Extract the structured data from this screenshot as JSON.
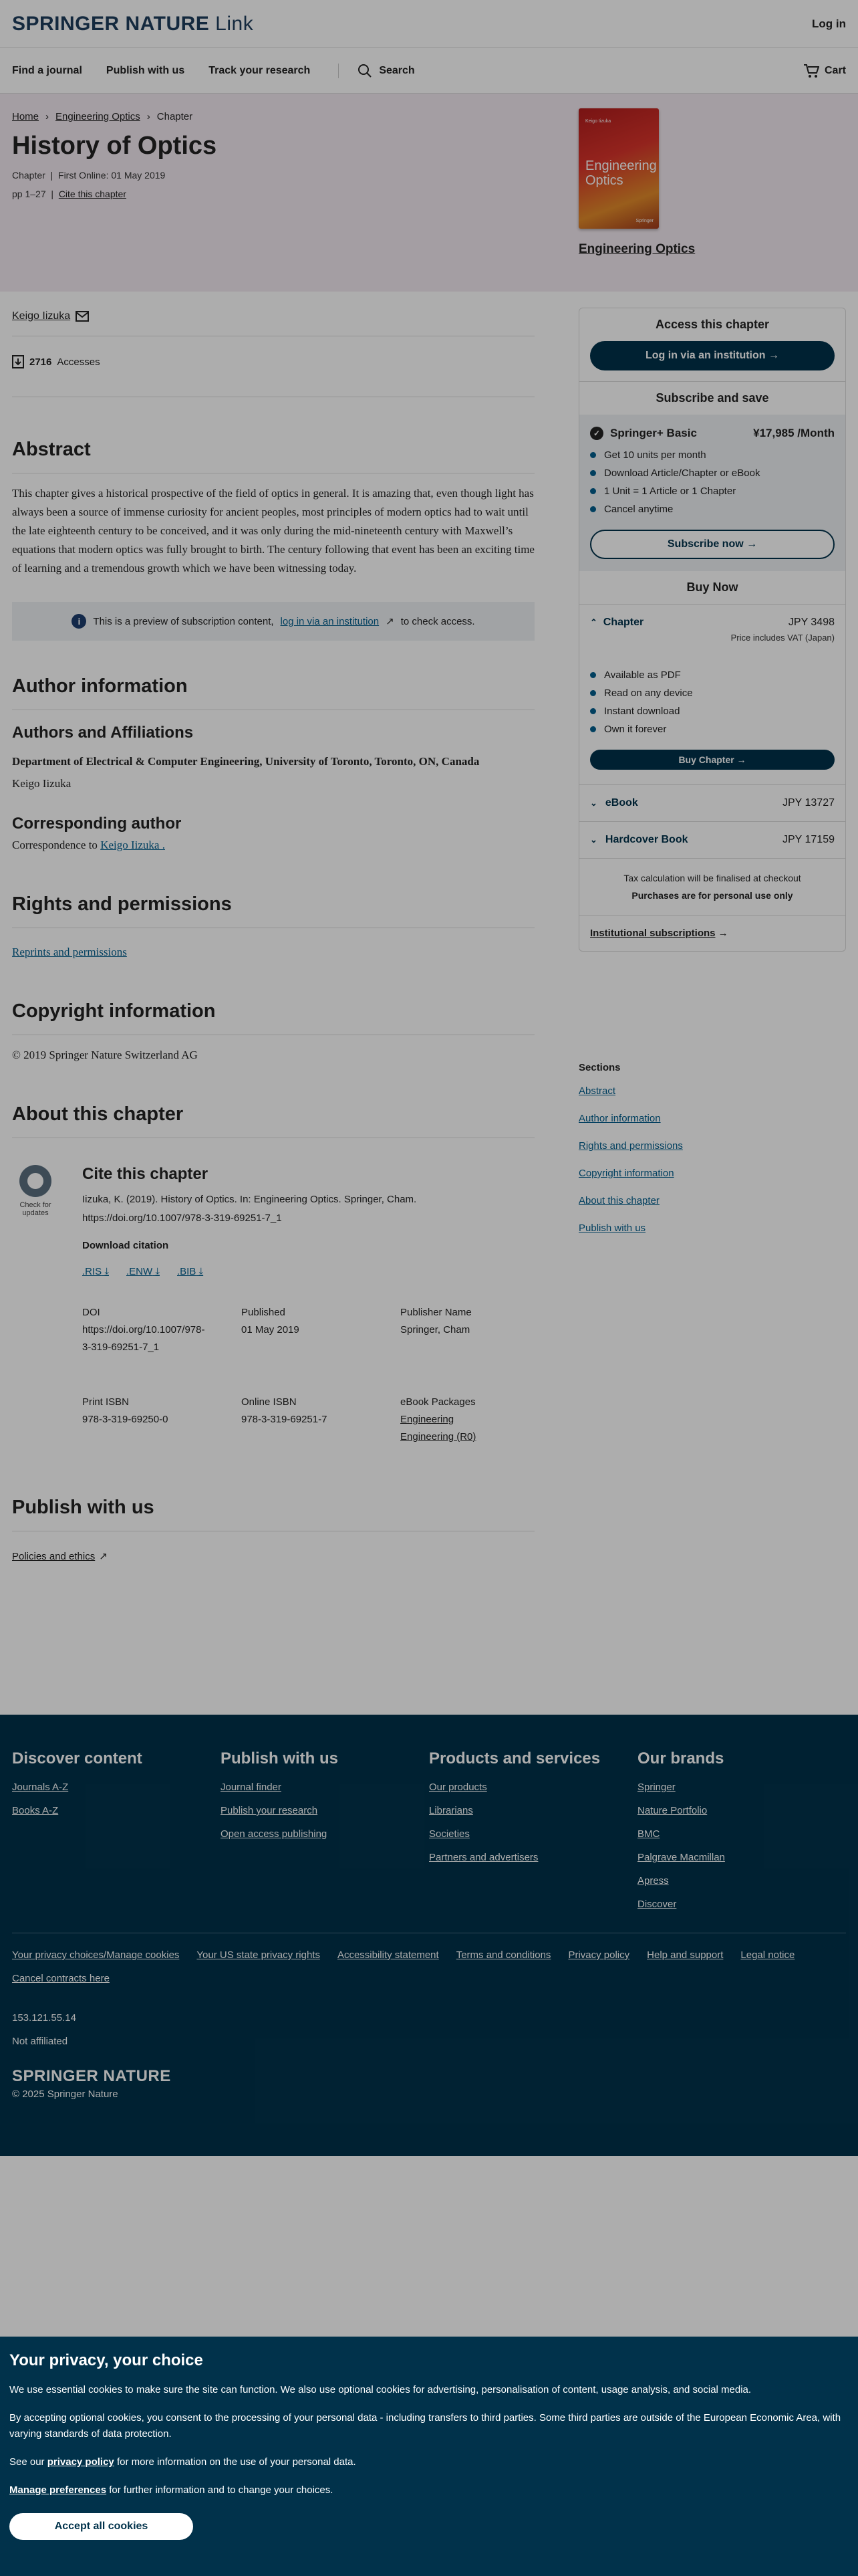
{
  "header": {
    "logo_bold": "SPRINGER NATURE",
    "logo_light": "Link",
    "login": "Log in"
  },
  "nav": {
    "find_journal": "Find a journal",
    "publish": "Publish with us",
    "track": "Track your research",
    "search": "Search",
    "cart": "Cart"
  },
  "breadcrumb": {
    "home": "Home",
    "book": "Engineering Optics",
    "current": "Chapter"
  },
  "chapter": {
    "title": "History of Optics",
    "type": "Chapter",
    "first_online": "First Online: 01 May 2019",
    "pages": "pp 1–27",
    "cite_link": "Cite this chapter"
  },
  "book": {
    "title": "Engineering Optics",
    "cover_title": "Engineering Optics",
    "cover_author": "Keigo Iizuka",
    "cover_publisher": "Springer"
  },
  "author": {
    "name": "Keigo Iizuka"
  },
  "metrics": {
    "accesses_count": "2716",
    "accesses_label": "Accesses"
  },
  "abstract": {
    "heading": "Abstract",
    "text": "This chapter gives a historical prospective of the field of optics in general. It is amazing that, even though light has always been a source of immense curiosity for ancient peoples, most principles of modern optics had to wait until the late eighteenth century to be conceived, and it was only during the mid-nineteenth century with Maxwell’s equations that modern optics was fully brought to birth. The century following that event has been an exciting time of learning and a tremendous growth which we have been witnessing today."
  },
  "preview": {
    "prefix": "This is a preview of subscription content,",
    "link": "log in via an institution",
    "suffix": "to check access."
  },
  "author_info": {
    "heading": "Author information",
    "affiliations_heading": "Authors and Affiliations",
    "department": "Department of Electrical & Computer Engineering, University of Toronto, Toronto, ON, Canada",
    "author": "Keigo Iizuka",
    "corresponding_heading": "Corresponding author",
    "correspondence_prefix": "Correspondence to",
    "correspondence_name": "Keigo Iizuka ."
  },
  "rights": {
    "heading": "Rights and permissions",
    "link": "Reprints and permissions"
  },
  "copyright": {
    "heading": "Copyright information",
    "text": "© 2019 Springer Nature Switzerland AG"
  },
  "about": {
    "heading": "About this chapter",
    "badge": "Check for updates",
    "cite_heading": "Cite this chapter",
    "cite_text": "Iizuka, K. (2019). History of Optics. In: Engineering Optics. Springer, Cham. https://doi.org/10.1007/978-3-319-69251-7_1",
    "download_heading": "Download citation",
    "formats": [
      ".RIS",
      ".ENW",
      ".BIB"
    ],
    "doi_label": "DOI",
    "doi_value": "https://doi.org/10.1007/978-3-319-69251-7_1",
    "published_label": "Published",
    "published_value": "01 May 2019",
    "publisher_label": "Publisher Name",
    "publisher_value": "Springer, Cham",
    "print_isbn_label": "Print ISBN",
    "print_isbn_value": "978-3-319-69250-0",
    "online_isbn_label": "Online ISBN",
    "online_isbn_value": "978-3-319-69251-7",
    "ebook_label": "eBook Packages",
    "ebook_values": [
      "Engineering",
      "Engineering (R0)"
    ]
  },
  "publish_with_us": {
    "heading": "Publish with us",
    "policies": "Policies and ethics"
  },
  "sidebar": {
    "access_heading": "Access this chapter",
    "login_btn": "Log in via an institution",
    "subscribe_heading": "Subscribe and save",
    "plan_name": "Springer+ Basic",
    "plan_price": "¥17,985 /Month",
    "plan_features": [
      "Get 10 units per month",
      "Download Article/Chapter or eBook",
      "1 Unit = 1 Article or 1 Chapter",
      "Cancel anytime"
    ],
    "subscribe_btn": "Subscribe now",
    "buy_heading": "Buy Now",
    "chapter_label": "Chapter",
    "chapter_price": "JPY 3498",
    "vat": "Price includes VAT (Japan)",
    "chapter_features": [
      "Available as PDF",
      "Read on any device",
      "Instant download",
      "Own it forever"
    ],
    "buy_btn": "Buy Chapter",
    "ebook_label": "eBook",
    "ebook_price": "JPY 13727",
    "hardcover_label": "Hardcover Book",
    "hardcover_price": "JPY 17159",
    "tax_note": "Tax calculation will be finalised at checkout",
    "personal_note": "Purchases are for personal use only",
    "institutional": "Institutional subscriptions"
  },
  "sections_nav": {
    "heading": "Sections",
    "items": [
      "Abstract",
      "Author information",
      "Rights and permissions",
      "Copyright information",
      "About this chapter",
      "Publish with us"
    ]
  },
  "footer": {
    "columns": [
      {
        "heading": "Discover content",
        "links": [
          "Journals A-Z",
          "Books A-Z"
        ]
      },
      {
        "heading": "Publish with us",
        "links": [
          "Journal finder",
          "Publish your research",
          "Open access publishing"
        ]
      },
      {
        "heading": "Products and services",
        "links": [
          "Our products",
          "Librarians",
          "Societies",
          "Partners and advertisers"
        ]
      },
      {
        "heading": "Our brands",
        "links": [
          "Springer",
          "Nature Portfolio",
          "BMC",
          "Palgrave Macmillan",
          "Apress",
          "Discover"
        ]
      }
    ],
    "legal": [
      "Your privacy choices/Manage cookies",
      "Your US state privacy rights",
      "Accessibility statement",
      "Terms and conditions",
      "Privacy policy",
      "Help and support",
      "Legal notice",
      "Cancel contracts here"
    ],
    "ip": "153.121.55.14",
    "affiliation": "Not affiliated",
    "logo": "SPRINGER NATURE",
    "copyright": "© 2025 Springer Nature"
  },
  "cookie": {
    "heading": "Your privacy, your choice",
    "p1": "We use essential cookies to make sure the site can function. We also use optional cookies for advertising, personalisation of content, usage analysis, and social media.",
    "p2": "By accepting optional cookies, you consent to the processing of your personal data - including transfers to third parties. Some third parties are outside of the European Economic Area, with varying standards of data protection.",
    "p3_prefix": "See our",
    "p3_link": "privacy policy",
    "p3_suffix": "for more information on the use of your personal data.",
    "p4_link": "Manage preferences",
    "p4_suffix": "for further information and to change your choices.",
    "accept": "Accept all cookies"
  },
  "icons": {
    "search": "search-icon",
    "cart": "cart-icon",
    "mail": "mail-icon",
    "download": "download-icon",
    "info": "info-icon",
    "external": "external-link-icon"
  }
}
